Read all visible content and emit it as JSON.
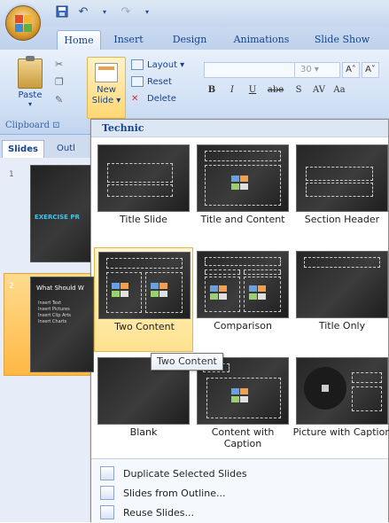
{
  "qat": {
    "save_icon": "save-icon",
    "undo_icon": "undo-icon",
    "redo_icon": "redo-icon",
    "dropdown_icon": "customize-icon"
  },
  "tabs": [
    {
      "label": "Home",
      "active": true
    },
    {
      "label": "Insert"
    },
    {
      "label": "Design"
    },
    {
      "label": "Animations"
    },
    {
      "label": "Slide Show"
    }
  ],
  "ribbon": {
    "paste_label": "Paste",
    "new_slide_label_1": "New",
    "new_slide_label_2": "Slide ▾",
    "layout_label": "Layout ▾",
    "reset_label": "Reset",
    "delete_label": "Delete",
    "clipboard_label": "Clipboard",
    "font_size": "30",
    "grow_font": "A˄",
    "shrink_font": "A˅",
    "format_buttons": [
      "B",
      "I",
      "U",
      "abe",
      "S",
      "AV",
      "Aa"
    ]
  },
  "panes": {
    "slides_tab": "Slides",
    "outline_tab": "Outl"
  },
  "slides": [
    {
      "num": "1",
      "title": "EXERCISE PR"
    },
    {
      "num": "2",
      "title": "What Should W",
      "bullets": [
        "Insert Text",
        "Insert Pictures",
        "Insert Clip Arts",
        "Insert Charts"
      ]
    }
  ],
  "gallery": {
    "header": "Technic",
    "layouts": [
      "Title Slide",
      "Title and Content",
      "Section Header",
      "Two Content",
      "Comparison",
      "Title Only",
      "Blank",
      "Content with Caption",
      "Picture with Caption"
    ],
    "tooltip": "Two Content",
    "menu": {
      "duplicate": "Duplicate Selected Slides",
      "from_outline": "Slides from Outline...",
      "reuse": "Reuse Slides..."
    }
  }
}
